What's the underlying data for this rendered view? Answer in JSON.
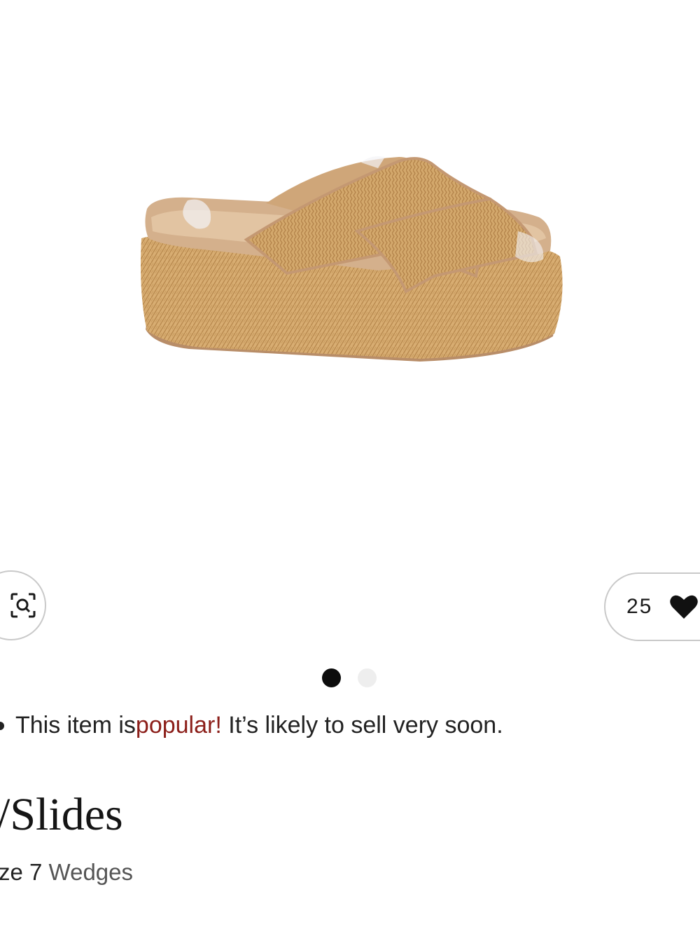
{
  "image": {
    "alt": "Tan woven platform criss-cross slide sandal"
  },
  "actions": {
    "visual_search_icon": "visual-search-icon",
    "favorites_count": "25",
    "favorites_icon": "heart-icon"
  },
  "carousel": {
    "total": 2,
    "active_index": 0
  },
  "notice": {
    "prefix": "This item is ",
    "highlight": "popular!",
    "suffix": " It’s likely to sell very soon.",
    "highlight_color": "#8c1f1a"
  },
  "product": {
    "title": "/Slides",
    "size_text": "ze 7",
    "category": "Wedges"
  }
}
